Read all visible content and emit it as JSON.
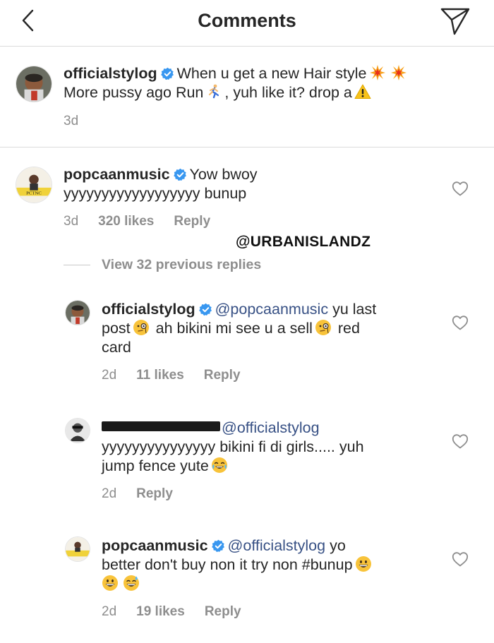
{
  "header": {
    "title": "Comments",
    "back_icon": "chevron-left-icon",
    "send_icon": "paper-plane-icon"
  },
  "caption": {
    "username": "officialstylog",
    "text_line1": "When u get a new Hair style",
    "text_line2a": "More pussy ago Run",
    "text_line2b": ", yuh like it? drop a",
    "time": "3d"
  },
  "comment": {
    "username": "popcaanmusic",
    "text_line1": "Yow bwoy",
    "text_line2": "yyyyyyyyyyyyyyyyyy bunup",
    "time": "3d",
    "likes": "320 likes",
    "reply": "Reply"
  },
  "watermark": "@URBANISLANDZ",
  "view_replies": "View 32 previous replies",
  "replies": [
    {
      "username": "officialstylog",
      "mention": "@popcaanmusic",
      "text_a": "yu last",
      "text_b": "post",
      "text_c": "ah bikini mi see u a sell",
      "text_d": "red",
      "text_e": "card",
      "time": "2d",
      "likes": "11 likes",
      "reply": "Reply"
    },
    {
      "username": "[redacted]",
      "mention": "@officialstylog",
      "text_a": "yyyyyyyyyyyyyyy bikini fi di girls..... yuh",
      "text_b": "jump fence yute",
      "time": "2d",
      "reply": "Reply"
    },
    {
      "username": "popcaanmusic",
      "mention": "@officialstylog",
      "text_a": "yo",
      "text_b": "better don't buy non it try non #bunup",
      "time": "2d",
      "likes": "19 likes",
      "reply": "Reply"
    }
  ],
  "colors": {
    "text": "#262626",
    "muted": "#8e8e8e",
    "verified": "#3897f0",
    "mention": "#385185",
    "divider": "#dbdbdb"
  }
}
